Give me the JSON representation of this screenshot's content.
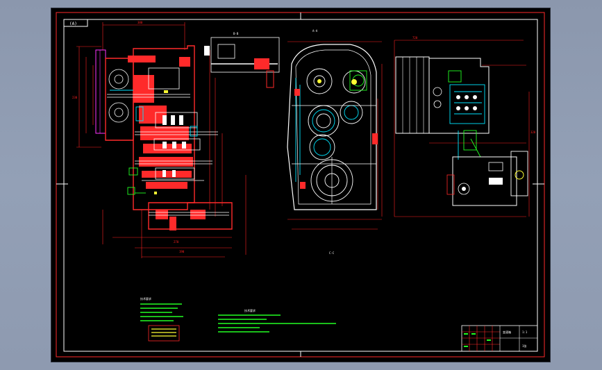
{
  "drawing": {
    "sheet_code": "(A)",
    "view_label_main": "A-A",
    "view_label_sec": "B-B",
    "view_label_bottom": "C-C"
  },
  "notes": {
    "left_heading": "技术要求",
    "right_heading": "技术要求"
  },
  "title_block": {
    "name": "变速箱",
    "scale": "1:1",
    "sheet": "1张"
  },
  "colors": {
    "paper": "#000000",
    "frame": "#ffffff",
    "outline": "#ff2a2a",
    "dimension": "#ff2020",
    "part_white": "#ffffff",
    "part_cyan": "#00e5ff",
    "part_green": "#22ff22",
    "part_yellow": "#ffff33",
    "part_magenta": "#ff33ff",
    "part_blue": "#3060ff"
  }
}
